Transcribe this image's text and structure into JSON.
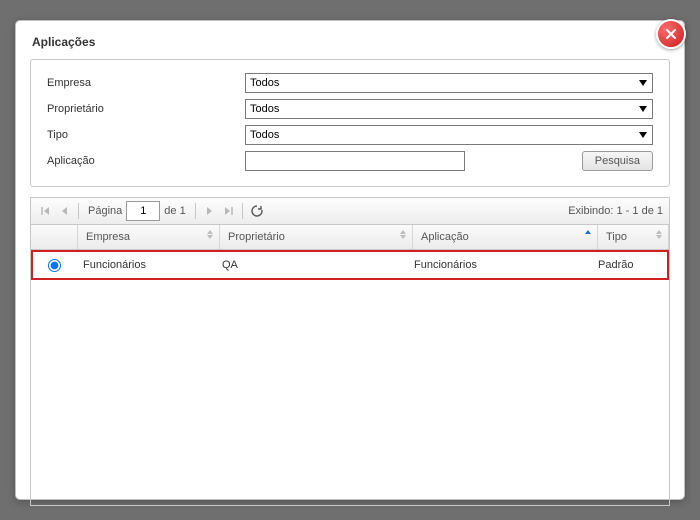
{
  "title": "Aplicações",
  "filters": {
    "empresa": {
      "label": "Empresa",
      "value": "Todos"
    },
    "proprietario": {
      "label": "Proprietário",
      "value": "Todos"
    },
    "tipo": {
      "label": "Tipo",
      "value": "Todos"
    },
    "aplicacao": {
      "label": "Aplicação",
      "value": ""
    },
    "search_label": "Pesquisa"
  },
  "pager": {
    "page_label": "Página",
    "current": "1",
    "of_label": "de",
    "total": "1",
    "status": "Exibindo: 1 - 1 de 1"
  },
  "grid": {
    "columns": [
      "Empresa",
      "Proprietário",
      "Aplicação",
      "Tipo"
    ],
    "sort": {
      "column": "Aplicação",
      "dir": "asc"
    },
    "rows": [
      {
        "selected": true,
        "empresa": "Funcionários",
        "proprietario": "QA",
        "aplicacao": "Funcionários",
        "tipo": "Padrão"
      }
    ]
  }
}
